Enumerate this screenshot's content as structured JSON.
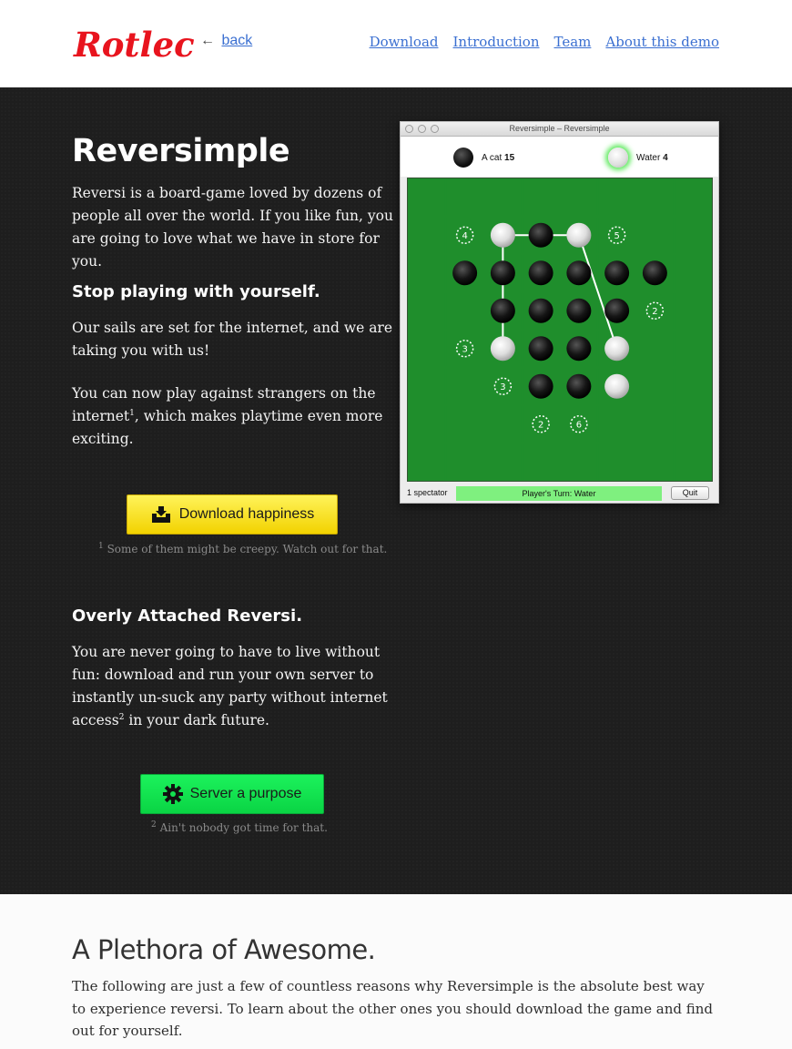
{
  "header": {
    "logo_text": "Rotlech",
    "back_arrow": "←",
    "back_label": "back",
    "nav": [
      "Download",
      "Introduction",
      "Team",
      "About this demo"
    ]
  },
  "hero": {
    "title": "Reversimple",
    "intro": "Reversi is a board-game loved by dozens of people all over the world. If you like fun, you are going to love what we have in store for you.",
    "section1_heading": "Stop playing with yourself.",
    "section1_p1": "Our sails are set for the internet, and we are taking you with us!",
    "section1_p2_a": "You can now play against strangers on the internet",
    "section1_p2_sup": "1",
    "section1_p2_b": ", which makes playtime even more exciting.",
    "download_button": "Download happiness",
    "footnote1_sup": "1",
    "footnote1": "Some of them might be creepy. Watch out for that.",
    "section2_heading": "Overly Attached Reversi.",
    "section2_p_a": "You are never going to have to live without fun: download and run your own server to instantly un-suck any party without internet access",
    "section2_p_sup": "2",
    "section2_p_b": " in your dark future.",
    "server_button": "Server a purpose",
    "footnote2_sup": "2",
    "footnote2": "Ain't nobody got time for that."
  },
  "game_window": {
    "title": "Reversimple – Reversimple",
    "player1_name": "A cat",
    "player1_score": "15",
    "player2_name": "Water",
    "player2_score": "4",
    "spectators": "1 spectator",
    "turn_label": "Player's Turn:  Water",
    "quit_label": "Quit",
    "board": [
      [
        "",
        "",
        "",
        "",
        "",
        "",
        "",
        ""
      ],
      [
        "",
        "4",
        "W",
        "B",
        "W",
        "5",
        "",
        ""
      ],
      [
        "",
        "B",
        "B",
        "B",
        "B",
        "B",
        "B",
        ""
      ],
      [
        "",
        "",
        "B",
        "B",
        "B",
        "B",
        "2",
        ""
      ],
      [
        "",
        "3",
        "W",
        "B",
        "B",
        "W",
        "",
        ""
      ],
      [
        "",
        "",
        "3",
        "B",
        "B",
        "W",
        "",
        ""
      ],
      [
        "",
        "",
        "",
        "2",
        "6",
        "",
        "",
        ""
      ],
      [
        "",
        "",
        "",
        "",
        "",
        "",
        "",
        ""
      ]
    ],
    "colors": {
      "felt": "#1f8e2c",
      "highlight": "#7ff07f"
    }
  },
  "bottom": {
    "heading": "A Plethora of Awesome.",
    "text": "The following are just a few of countless reasons why Reversimple is the absolute best way to experience reversi. To learn about the other ones you should download the game and find out for yourself."
  },
  "colors": {
    "logo": "#e8141e",
    "link": "#3a6fd1",
    "button_yellow": "#f7e31a",
    "button_green": "#10e04e"
  }
}
